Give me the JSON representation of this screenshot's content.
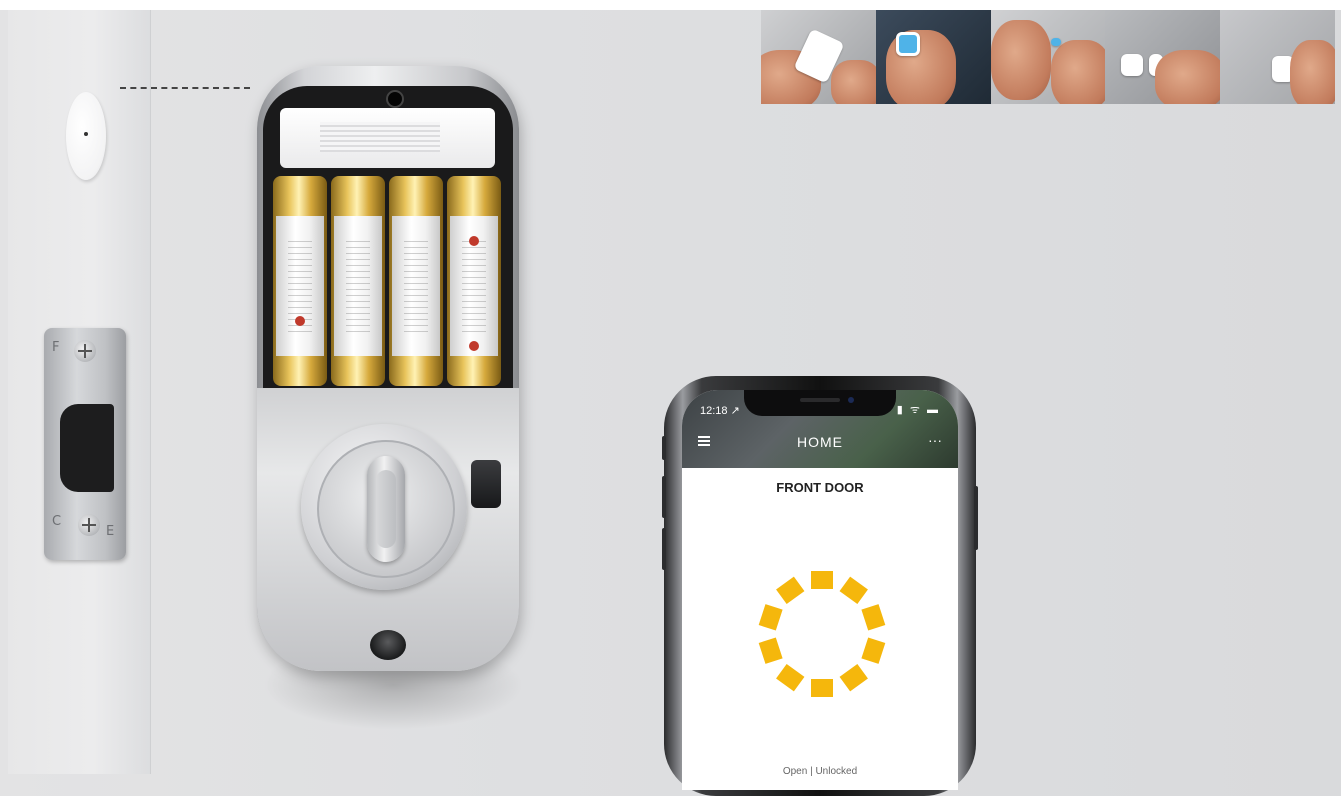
{
  "phone": {
    "status_time": "12:18 ↗",
    "status_icons": "▮ ᯤ ▬",
    "app_title": "HOME",
    "more_label": "···",
    "door_name": "FRONT DOOR",
    "lock_status": "Open | Unlocked",
    "spinner_color": "#f5b70c"
  },
  "strike_plate": {
    "etch_top": "F",
    "etch_bottom_left": "C",
    "etch_bottom_right": "E"
  },
  "colors": {
    "background": "#dedfe1",
    "spinner_accent": "#f5b70c",
    "battery_gold": "#d6a93c"
  }
}
